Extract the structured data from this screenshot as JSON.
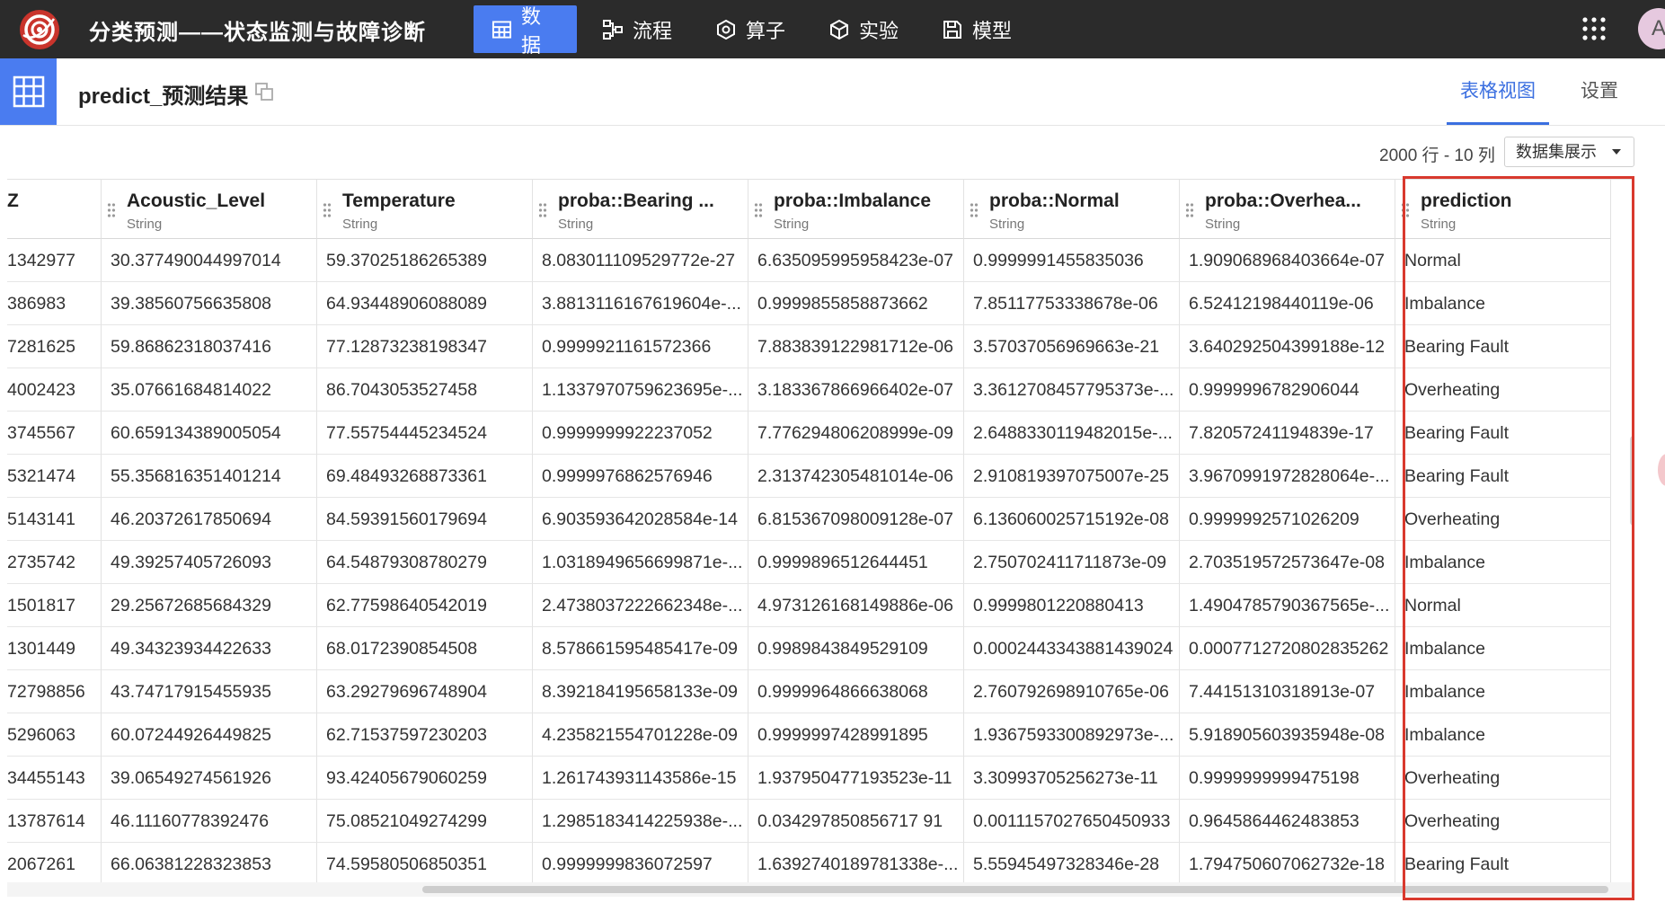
{
  "app": {
    "title": "分类预测——状态监测与故障诊断",
    "avatar_letter": "A"
  },
  "nav": [
    {
      "label": "数据",
      "icon": "table-icon",
      "active": true
    },
    {
      "label": "流程",
      "icon": "flow-icon",
      "active": false
    },
    {
      "label": "算子",
      "icon": "operator-icon",
      "active": false
    },
    {
      "label": "实验",
      "icon": "cube-icon",
      "active": false
    },
    {
      "label": "模型",
      "icon": "save-icon",
      "active": false
    }
  ],
  "dataset": {
    "name": "predict_预测结果",
    "tabs": [
      {
        "label": "表格视图",
        "active": true
      },
      {
        "label": "设置",
        "active": false
      }
    ],
    "row_count": "2000 行 - 10 列",
    "view_select": "数据集展示"
  },
  "table": {
    "columns": [
      {
        "name": "Z",
        "type": ""
      },
      {
        "name": "Acoustic_Level",
        "type": "String"
      },
      {
        "name": "Temperature",
        "type": "String"
      },
      {
        "name": "proba::Bearing ...",
        "type": "String"
      },
      {
        "name": "proba::Imbalance",
        "type": "String"
      },
      {
        "name": "proba::Normal",
        "type": "String"
      },
      {
        "name": "proba::Overhea...",
        "type": "String"
      },
      {
        "name": "prediction",
        "type": "String"
      }
    ],
    "rows": [
      [
        "1342977",
        "30.377490044997014",
        "59.37025186265389",
        "8.083011109529772e-27",
        "6.635095995958423e-07",
        "0.9999991455835036",
        "1.909068968403664e-07",
        "Normal"
      ],
      [
        "386983",
        "39.38560756635808",
        "64.93448906088089",
        "3.8813116167619604e-...",
        "0.9999855858873662",
        "7.85117753338678e-06",
        "6.52412198440119e-06",
        "Imbalance"
      ],
      [
        "7281625",
        "59.86862318037416",
        "77.12873238198347",
        "0.9999921161572366",
        "7.883839122981712e-06",
        "3.57037056969663e-21",
        "3.640292504399188e-12",
        "Bearing Fault"
      ],
      [
        "4002423",
        "35.07661684814022",
        "86.7043053527458",
        "1.1337970759623695e-...",
        "3.183367866966402e-07",
        "3.3612708457795373e-...",
        "0.9999996782906044",
        "Overheating"
      ],
      [
        "3745567",
        "60.659134389005054",
        "77.55754445234524",
        "0.9999999922237052",
        "7.776294806208999e-09",
        "2.6488330119482015e-...",
        "7.82057241194839e-17",
        "Bearing Fault"
      ],
      [
        "5321474",
        "55.356816351401214",
        "69.48493268873361",
        "0.9999976862576946",
        "2.313742305481014e-06",
        "2.910819397075007e-25",
        "3.9670991972828064e-...",
        "Bearing Fault"
      ],
      [
        "5143141",
        "46.20372617850694",
        "84.59391560179694",
        "6.903593642028584e-14",
        "6.815367098009128e-07",
        "6.136060025715192e-08",
        "0.9999992571026209",
        "Overheating"
      ],
      [
        "2735742",
        "49.39257405726093",
        "64.54879308780279",
        "1.0318949656699871e-...",
        "0.9999896512644451",
        "2.750702411711873e-09",
        "2.703519572573647e-08",
        "Imbalance"
      ],
      [
        "1501817",
        "29.25672685684329",
        "62.77598640542019",
        "2.4738037222662348e-...",
        "4.973126168149886e-06",
        "0.9999801220880413",
        "1.4904785790367565e-...",
        "Normal"
      ],
      [
        "1301449",
        "49.34323934422633",
        "68.0172390854508",
        "8.578661595485417e-09",
        "0.9989843849529109",
        "0.0002443343881439024",
        "0.0007712720802835262",
        "Imbalance"
      ],
      [
        "72798856",
        "43.74717915455935",
        "63.29279696748904",
        "8.392184195658133e-09",
        "0.9999964866638068",
        "2.760792698910765e-06",
        "7.44151310318913e-07",
        "Imbalance"
      ],
      [
        "5296063",
        "60.07244926449825",
        "62.71537597230203",
        "4.235821554701228e-09",
        "0.9999997428991895",
        "1.9367593300892973e-...",
        "5.918905603935948e-08",
        "Imbalance"
      ],
      [
        "34455143",
        "39.06549274561926",
        "93.42405679060259",
        "1.261743931143586e-15",
        "1.937950477193523e-11",
        "3.30993705256273e-11",
        "0.9999999999475198",
        "Overheating"
      ],
      [
        "13787614",
        "46.11160778392476",
        "75.08521049274299",
        "1.2985183414225938e-...",
        "0.034297850856717 91",
        "0.0011157027650450933",
        "0.9645864462483853",
        "Overheating"
      ],
      [
        "2067261",
        "66.06381228323853",
        "74.59580506850351",
        "0.9999999836072597",
        "1.6392740189781338e-...",
        "5.55945497328346e-28",
        "1.794750607062732e-18",
        "Bearing Fault"
      ]
    ]
  },
  "colors": {
    "topbar": "#2b2b2b",
    "accent": "#4a7cf0",
    "highlight": "#d9392e"
  }
}
